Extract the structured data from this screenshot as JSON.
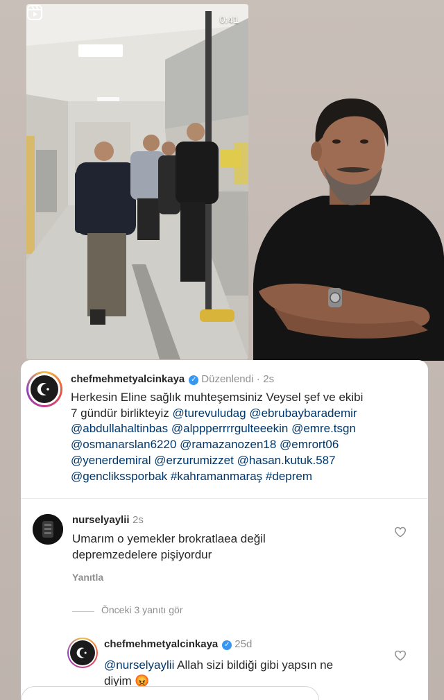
{
  "video": {
    "time": "0:41",
    "reels_icon": "reels-icon"
  },
  "post": {
    "username": "chefmehmetyalcinkaya",
    "edited_label": "Düzenlendi",
    "separator": "·",
    "time": "2s",
    "caption_lines": [
      [
        {
          "t": "Herkesin Eline sağlık muhteşemsiniz Veysel şef ve ekibi",
          "k": "text"
        }
      ],
      [
        {
          "t": "7 gündür birlikteyiz ",
          "k": "text"
        },
        {
          "t": "@turevuludag",
          "k": "mention"
        },
        {
          "t": " ",
          "k": "text"
        },
        {
          "t": "@ebrubaybarademir",
          "k": "mention"
        }
      ],
      [
        {
          "t": "@abdullahaltinbas",
          "k": "mention"
        },
        {
          "t": " ",
          "k": "text"
        },
        {
          "t": "@alppperrrrgulteeekin",
          "k": "mention"
        },
        {
          "t": " ",
          "k": "text"
        },
        {
          "t": "@emre.tsgn",
          "k": "mention"
        }
      ],
      [
        {
          "t": "@osmanarslan6220",
          "k": "mention"
        },
        {
          "t": " ",
          "k": "text"
        },
        {
          "t": "@ramazanozen18",
          "k": "mention"
        },
        {
          "t": " ",
          "k": "text"
        },
        {
          "t": "@emrort06",
          "k": "mention"
        }
      ],
      [
        {
          "t": "@yenerdemiral",
          "k": "mention"
        },
        {
          "t": " ",
          "k": "text"
        },
        {
          "t": "@erzurumizzet",
          "k": "mention"
        },
        {
          "t": "  ",
          "k": "text"
        },
        {
          "t": "@hasan.kutuk.587",
          "k": "mention"
        }
      ],
      [
        {
          "t": "@genclikssporbak",
          "k": "mention"
        },
        {
          "t": " ",
          "k": "text"
        },
        {
          "t": "#kahramanmaraş",
          "k": "hashtag"
        },
        {
          "t": " ",
          "k": "text"
        },
        {
          "t": "#deprem",
          "k": "hashtag"
        }
      ]
    ]
  },
  "comment1": {
    "username": "nurselyaylii",
    "time": "2s",
    "line1": "Umarım o yemekler brokratlaea değil",
    "line2": "depremzedelere pişiyordur",
    "reply_label": "Yanıtla"
  },
  "replies": {
    "view_previous": "Önceki 3 yanıtı gör"
  },
  "reply": {
    "username": "chefmehmetyalcinkaya",
    "time": "25d",
    "mention": "@nurselyaylii",
    "text_rest": " Allah sizi bildiği gibi yapsın ne",
    "line2": "diyim",
    "emoji": "😡"
  },
  "colors": {
    "mention": "#00376b",
    "verified": "#3797f0",
    "muted": "#8e8e8e"
  }
}
